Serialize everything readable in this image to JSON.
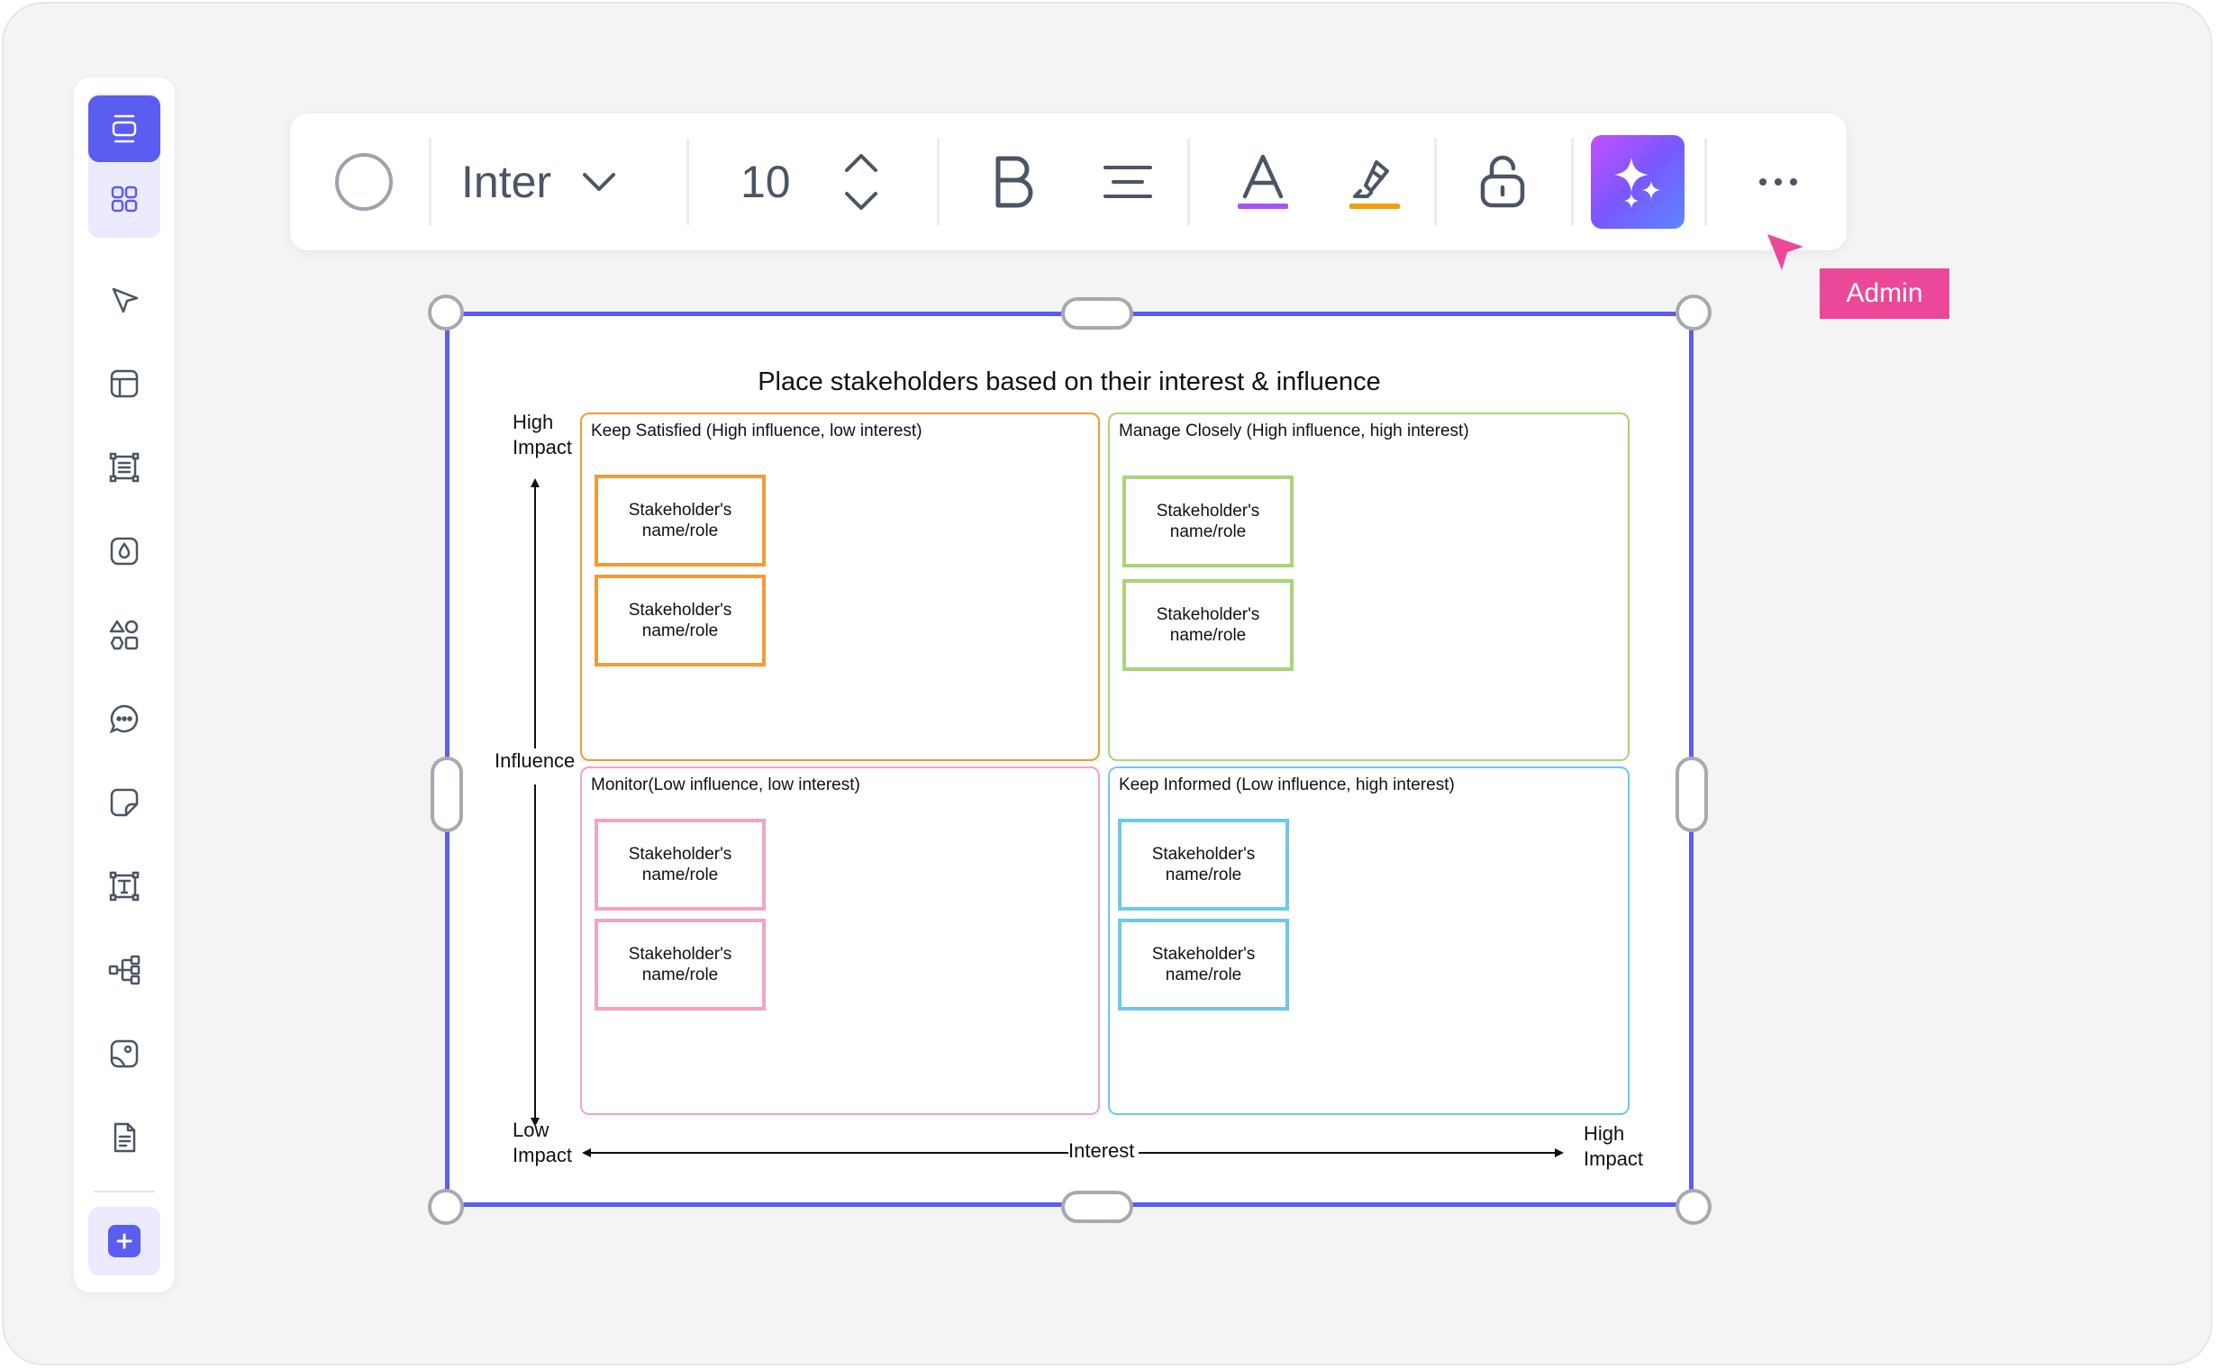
{
  "colors": {
    "accent": "#5b5cf0",
    "keep_satisfied": "#f39a3a",
    "manage_closely": "#a9d47a",
    "monitor": "#f3a4c3",
    "keep_informed": "#70c8e8",
    "cursor": "#ec4899"
  },
  "sidebar": {
    "items": [
      {
        "name": "frames",
        "icon": "frame-icon"
      },
      {
        "name": "templates",
        "icon": "grid-icon"
      },
      {
        "name": "select",
        "icon": "pointer-icon"
      },
      {
        "name": "layout",
        "icon": "layout-icon"
      },
      {
        "name": "table",
        "icon": "table-icon"
      },
      {
        "name": "fill",
        "icon": "drop-icon"
      },
      {
        "name": "shapes",
        "icon": "shapes-icon"
      },
      {
        "name": "comment",
        "icon": "comment-icon"
      },
      {
        "name": "sticky-note",
        "icon": "sticky-note-icon"
      },
      {
        "name": "text",
        "icon": "text-icon"
      },
      {
        "name": "mind-map",
        "icon": "mindmap-icon"
      },
      {
        "name": "image",
        "icon": "image-icon"
      },
      {
        "name": "document",
        "icon": "document-icon"
      },
      {
        "name": "add",
        "icon": "plus-icon"
      }
    ]
  },
  "toolbar": {
    "font_family": "Inter",
    "font_size": "10",
    "more_icon": "more-icon"
  },
  "cursor": {
    "label": "Admin"
  },
  "matrix": {
    "title": "Place stakeholders based on their interest & influence",
    "y_axis": {
      "top": "High\nImpact",
      "label": "Influence",
      "bottom": "Low\nImpact"
    },
    "x_axis": {
      "label": "Interest",
      "right": "High\nImpact"
    },
    "quadrants": [
      {
        "title": "Keep Satisfied (High influence, low interest)",
        "cards": [
          "Stakeholder's\nname/role",
          "Stakeholder's\nname/role"
        ]
      },
      {
        "title": "Manage Closely (High influence, high interest)",
        "cards": [
          "Stakeholder's\nname/role",
          "Stakeholder's\nname/role"
        ]
      },
      {
        "title": "Monitor(Low influence, low interest)",
        "cards": [
          "Stakeholder's\nname/role",
          "Stakeholder's\nname/role"
        ]
      },
      {
        "title": "Keep Informed (Low influence, high interest)",
        "cards": [
          "Stakeholder's\nname/role",
          "Stakeholder's\nname/role"
        ]
      }
    ]
  }
}
